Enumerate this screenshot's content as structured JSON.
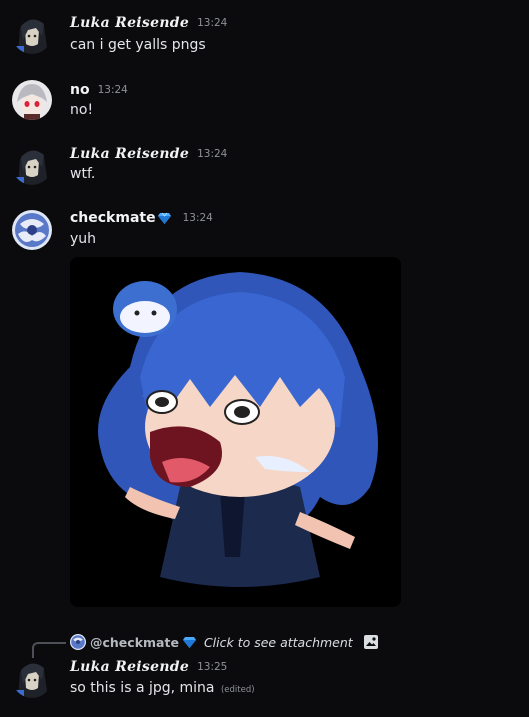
{
  "messages": [
    {
      "author": "Luka Reisende",
      "time": "13:24",
      "text": "can i get yalls pngs"
    },
    {
      "author": "no",
      "time": "13:24",
      "text": "no!"
    },
    {
      "author": "Luka Reisende",
      "time": "13:24",
      "text": "wtf."
    },
    {
      "author": "checkmate",
      "time": "13:24",
      "text": "yuh"
    },
    {
      "author": "Luka Reisende",
      "time": "13:25",
      "text": "so this is a jpg, mina",
      "edited": "(edited)"
    }
  ],
  "reply": {
    "mention": "@checkmate",
    "text": "Click to see attachment"
  },
  "icons": {
    "badge": "diamond-gem-icon",
    "attachment": "image-icon"
  },
  "colors": {
    "background": "#0b0b0d",
    "badge": "#4aa8ff"
  }
}
